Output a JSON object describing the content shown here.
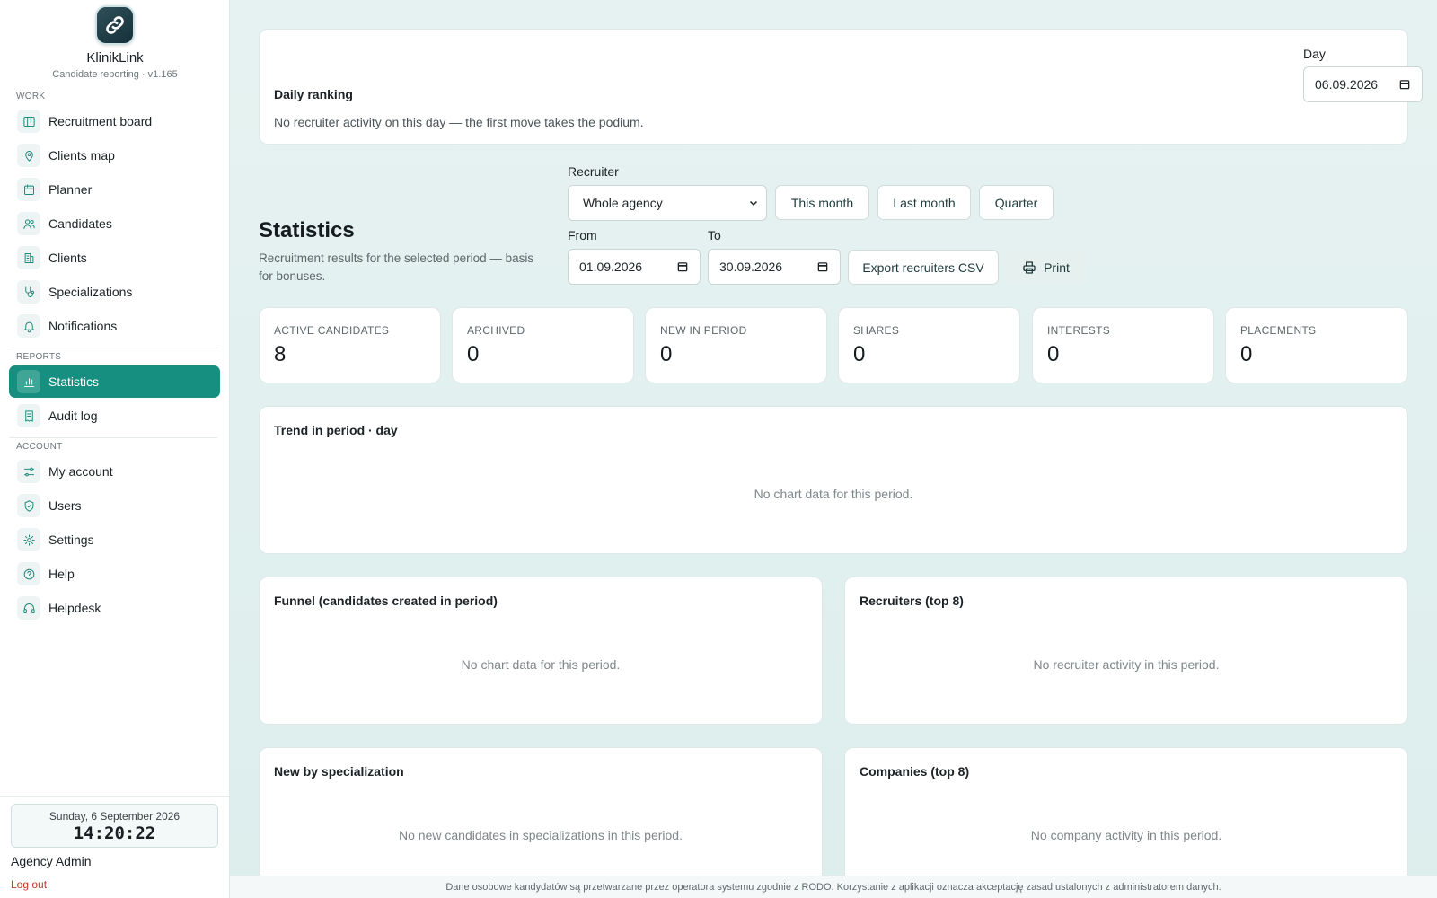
{
  "brand": {
    "name": "KlinikLink",
    "subtitle": "Candidate reporting · v1.165"
  },
  "sidebar": {
    "sections": {
      "work": "WORK",
      "reports": "REPORTS",
      "account": "ACCOUNT"
    },
    "items": [
      {
        "label": "Recruitment board",
        "icon": "board-icon"
      },
      {
        "label": "Clients map",
        "icon": "map-pin-icon"
      },
      {
        "label": "Planner",
        "icon": "calendar-icon"
      },
      {
        "label": "Candidates",
        "icon": "users-icon"
      },
      {
        "label": "Clients",
        "icon": "building-icon"
      },
      {
        "label": "Specializations",
        "icon": "stethoscope-icon"
      },
      {
        "label": "Notifications",
        "icon": "bell-icon"
      },
      {
        "label": "Statistics",
        "icon": "bar-chart-icon",
        "active": true
      },
      {
        "label": "Audit log",
        "icon": "receipt-icon"
      },
      {
        "label": "My account",
        "icon": "sliders-icon"
      },
      {
        "label": "Users",
        "icon": "shield-icon"
      },
      {
        "label": "Settings",
        "icon": "gear-icon"
      },
      {
        "label": "Help",
        "icon": "help-circle-icon"
      },
      {
        "label": "Helpdesk",
        "icon": "headset-icon"
      }
    ],
    "clock": {
      "date": "Sunday, 6 September 2026",
      "time": "14:20:22"
    },
    "user": "Agency Admin",
    "logout": "Log out"
  },
  "ranking": {
    "title": "Daily ranking",
    "text": "No recruiter activity on this day — the first move takes the podium.",
    "day_label": "Day",
    "day_value": "06.09.2026"
  },
  "stats": {
    "title": "Statistics",
    "subtitle": "Recruitment results for the selected period — basis for bonuses."
  },
  "filters": {
    "recruiter_label": "Recruiter",
    "recruiter_value": "Whole agency",
    "this_month": "This month",
    "last_month": "Last month",
    "quarter": "Quarter",
    "from_label": "From",
    "from_value": "01.09.2026",
    "to_label": "To",
    "to_value": "30.09.2026",
    "export": "Export recruiters CSV",
    "print": "Print"
  },
  "kpis": [
    {
      "label": "ACTIVE CANDIDATES",
      "value": "8"
    },
    {
      "label": "ARCHIVED",
      "value": "0"
    },
    {
      "label": "NEW IN PERIOD",
      "value": "0"
    },
    {
      "label": "SHARES",
      "value": "0"
    },
    {
      "label": "INTERESTS",
      "value": "0"
    },
    {
      "label": "PLACEMENTS",
      "value": "0"
    }
  ],
  "panels": {
    "trend": {
      "title": "Trend in period · day",
      "empty": "No chart data for this period."
    },
    "funnel": {
      "title": "Funnel (candidates created in period)",
      "empty": "No chart data for this period."
    },
    "recruiters": {
      "title": "Recruiters (top 8)",
      "empty": "No recruiter activity in this period."
    },
    "specialization": {
      "title": "New by specialization",
      "empty": "No new candidates in specializations in this period."
    },
    "companies": {
      "title": "Companies (top 8)",
      "empty": "No company activity in this period."
    }
  },
  "footer": "Dane osobowe kandydatów są przetwarzane przez operatora systemu zgodnie z RODO. Korzystanie z aplikacji oznacza akceptację zasad ustalonych z administratorem danych.",
  "colors": {
    "accent": "#168f80",
    "accent_icon": "#1f8a7b",
    "background": "#e3f1ef",
    "logout": "#c0392b"
  }
}
